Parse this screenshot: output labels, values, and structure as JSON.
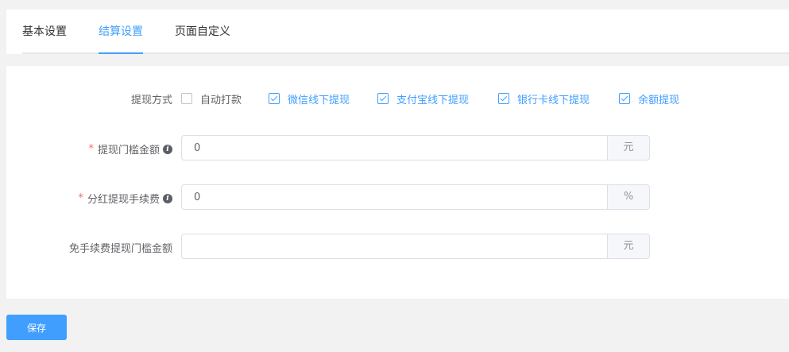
{
  "tabs": [
    {
      "label": "基本设置",
      "active": false
    },
    {
      "label": "结算设置",
      "active": true
    },
    {
      "label": "页面自定义",
      "active": false
    }
  ],
  "form": {
    "withdraw_method": {
      "label": "提现方式",
      "options": [
        {
          "label": "自动打款",
          "checked": false
        },
        {
          "label": "微信线下提现",
          "checked": true
        },
        {
          "label": "支付宝线下提现",
          "checked": true
        },
        {
          "label": "银行卡线下提现",
          "checked": true
        },
        {
          "label": "余额提现",
          "checked": true
        }
      ]
    },
    "threshold": {
      "label": "提现门槛金额",
      "required": true,
      "value": "0",
      "unit": "元",
      "info_icon": "info-icon"
    },
    "fee": {
      "label": "分红提现手续费",
      "required": true,
      "value": "0",
      "unit": "%",
      "info_icon": "info-icon"
    },
    "fee_free": {
      "label": "免手续费提现门槛金额",
      "required": false,
      "value": "",
      "unit": "元"
    }
  },
  "actions": {
    "save_label": "保存"
  },
  "colors": {
    "primary": "#409eff",
    "required": "#f56c6c"
  }
}
